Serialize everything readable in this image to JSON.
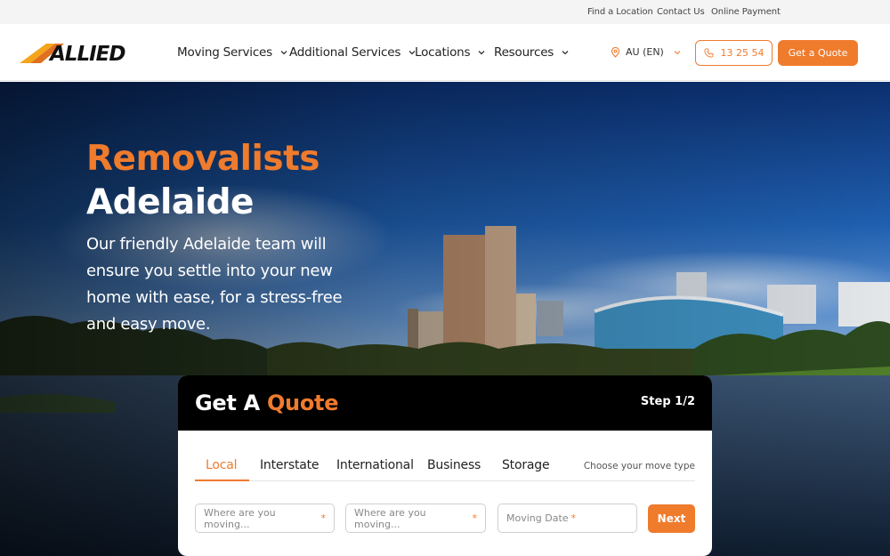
{
  "topbar": {
    "links": [
      {
        "label": "Find a Location"
      },
      {
        "label": "Contact Us"
      },
      {
        "label": "Online Payment"
      }
    ]
  },
  "header": {
    "logo_text": "ALLIED",
    "nav": [
      {
        "label": "Moving Services"
      },
      {
        "label": "Additional Services"
      },
      {
        "label": "Locations"
      },
      {
        "label": "Resources"
      }
    ],
    "locale": "AU (EN)",
    "phone": "13 25 54",
    "cta": "Get a Quote"
  },
  "hero": {
    "title_line1": "Removalists",
    "title_line2": "Adelaide",
    "description": "Our friendly Adelaide team will ensure you settle into your new home with ease, for a stress-free and easy move."
  },
  "quote_card": {
    "title_prefix": "Get A",
    "title_accent": "Quote",
    "step": "Step 1/2",
    "tabs": [
      {
        "label": "Local",
        "active": true
      },
      {
        "label": "Interstate",
        "active": false
      },
      {
        "label": "International",
        "active": false
      },
      {
        "label": "Business",
        "active": false
      },
      {
        "label": "Storage",
        "active": false
      }
    ],
    "tab_hint": "Choose your move type",
    "fields": [
      {
        "placeholder": "Where are you moving...",
        "required_mark": "*"
      },
      {
        "placeholder": "Where are you moving...",
        "required_mark": "*"
      },
      {
        "placeholder": "Moving Date",
        "required_mark": "*"
      }
    ],
    "next_label": "Next"
  },
  "colors": {
    "accent": "#ef7b2d",
    "card_header": "#000000",
    "topbar_bg": "#f4f4f4"
  }
}
